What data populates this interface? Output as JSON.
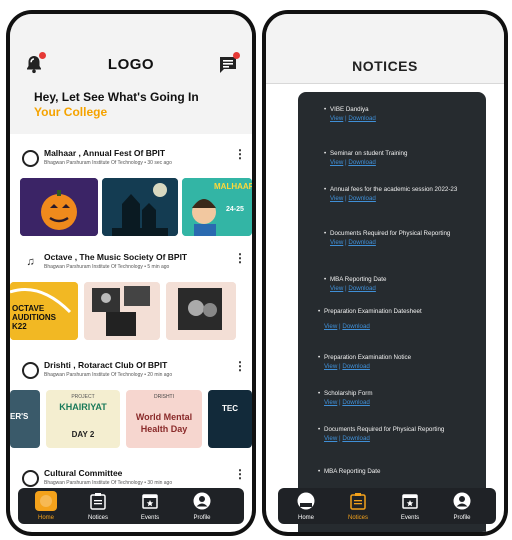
{
  "home": {
    "logo": "LOGO",
    "greeting_line1": "Hey, Let See What's Going In",
    "greeting_line2": "Your College",
    "posts": [
      {
        "name": "Malhaar , Annual Fest Of BPIT",
        "meta": "Bhagwan Parshuram Institute Of Technology • 30 sec ago"
      },
      {
        "name": "Octave , The Music Society Of BPIT",
        "meta": "Bhagwan Parshuram Institute Of Technology • 5 min ago"
      },
      {
        "name": "Drishti , Rotaract Club Of BPIT",
        "meta": "Bhagwan Parshuram Institute Of Technology • 20 min ago"
      },
      {
        "name": "Cultural Committee",
        "meta": "Bhagwan Parshuram Institute Of Technology • 30 min ago"
      }
    ],
    "thumb_texts": {
      "malhaar": "MALHAAR",
      "malhaar_date": "24-25",
      "octave1": "OCTAVE",
      "octave2": "AUDITIONS",
      "octave3": "K22",
      "drishti_left": "ER'S",
      "khairiyat_label": "PROJECT",
      "khairiyat": "KHAIRIYAT",
      "khairiyat_day": "DAY 2",
      "wmh_top": "DRISHTI",
      "wmh1": "World Mental",
      "wmh2": "Health Day",
      "tec": "TEC"
    }
  },
  "notices": {
    "title": "NOTICES",
    "view_label": "View",
    "sep": " | ",
    "download_label": "Download",
    "items": [
      "VIBE Dandiya",
      "Seminar on student Training",
      "Annual fees for the academic session 2022-23",
      "Documents Required for Physical Reporting",
      "MBA Reporting Date",
      "Preparation Examination Datesheet",
      "Preparation Examination Notice",
      "Scholarship Form",
      "Documents Required for Physical Reporting",
      "MBA Reporting Date"
    ]
  },
  "nav": {
    "items": [
      "Home",
      "Notices",
      "Events",
      "Profile"
    ],
    "left_active": "Home",
    "right_active": "Notices"
  },
  "colors": {
    "accent": "#f4a21b",
    "nav_bg": "#1f2226",
    "panel_bg": "#262b2f",
    "link": "#3f8fd7",
    "badge": "#e53935"
  }
}
